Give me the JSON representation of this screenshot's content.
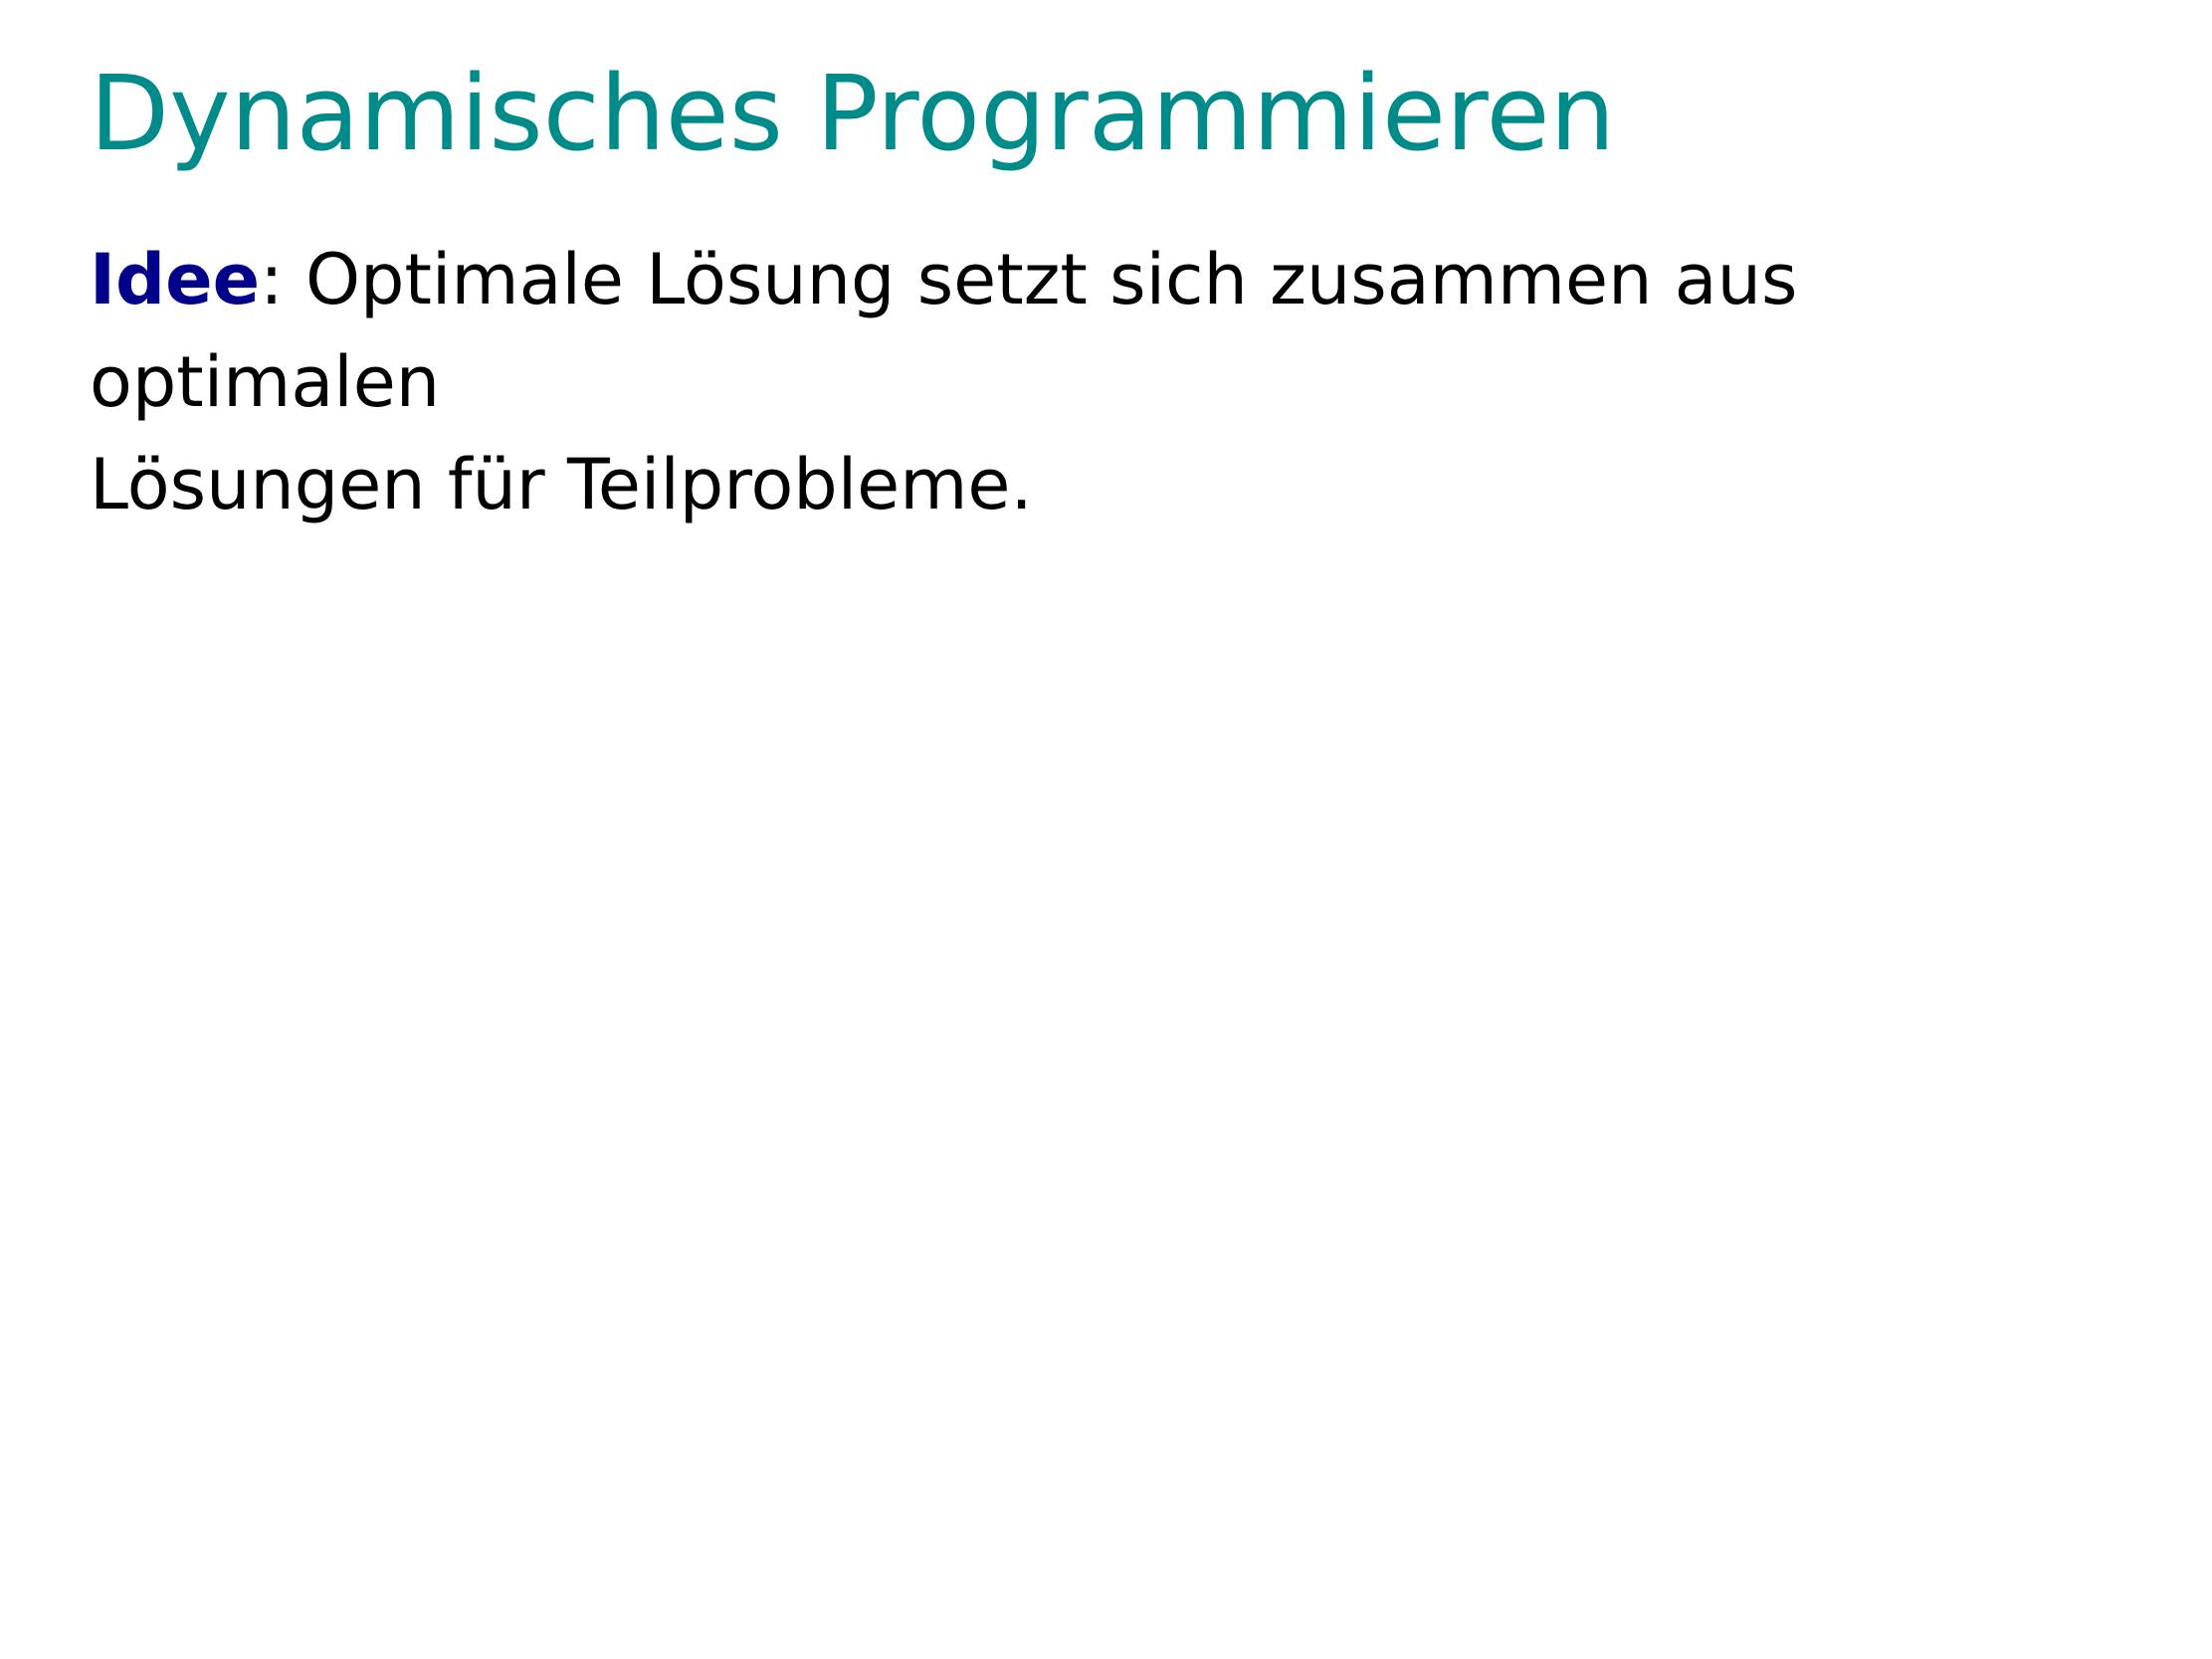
{
  "slide": {
    "title": "Dynamisches Programmieren",
    "idea": {
      "term": "Idee",
      "separator": ":",
      "line1": " Optimale Lösung setzt sich zusammen aus optimalen",
      "line2": "Lösungen für Teilprobleme."
    }
  },
  "colors": {
    "title": "#008B8B",
    "alert": "#00008B",
    "text": "#000000",
    "background": "#ffffff"
  }
}
